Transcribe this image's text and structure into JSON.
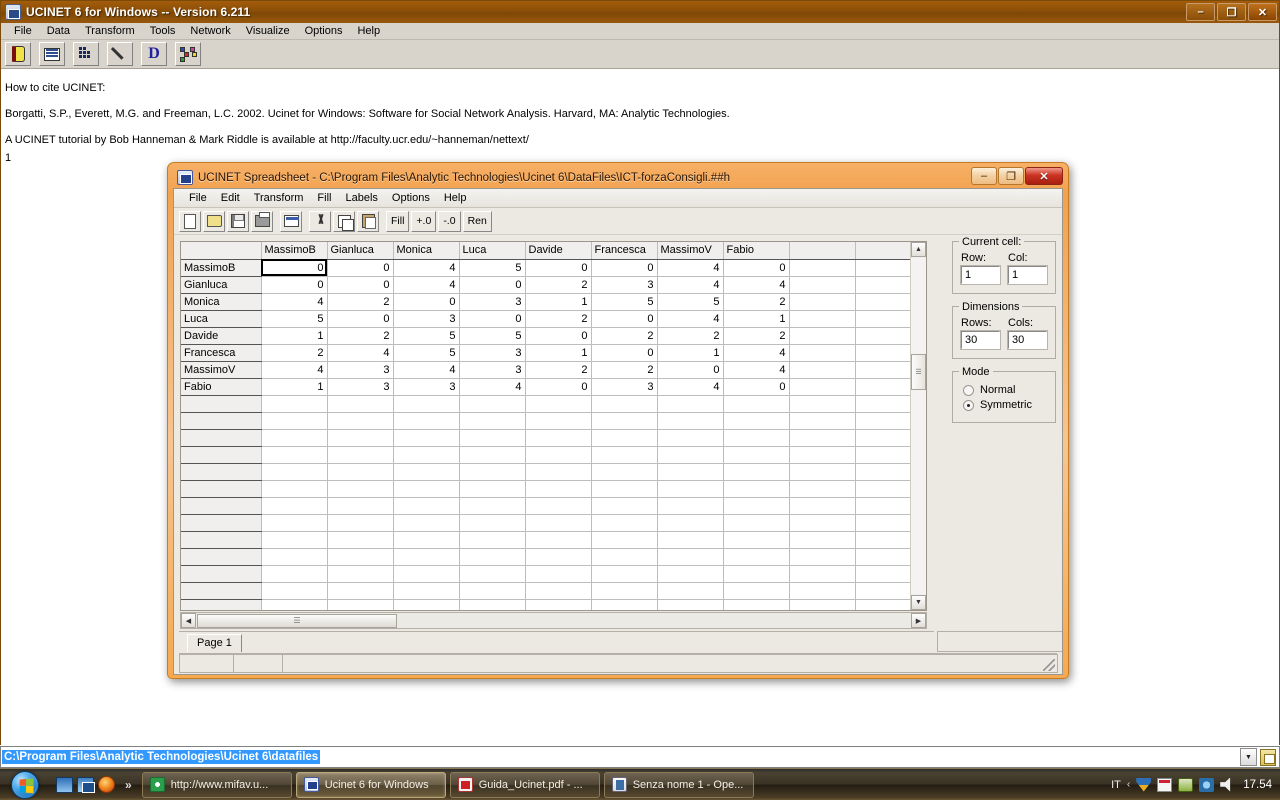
{
  "main_window": {
    "title": "UCINET 6 for Windows -- Version 6.211",
    "icon": "ucinet-app-icon",
    "window_buttons": {
      "minimize": "–",
      "maximize": "❐",
      "close": "✕"
    },
    "menu": [
      "File",
      "Data",
      "Transform",
      "Tools",
      "Network",
      "Visualize",
      "Options",
      "Help"
    ],
    "toolbar": [
      {
        "name": "exit-door-icon",
        "glyph": "door"
      },
      {
        "name": "spreadsheet-icon",
        "glyph": "sheet"
      },
      {
        "name": "matrix-icon",
        "glyph": "matrix"
      },
      {
        "name": "pencil-icon",
        "glyph": "pencil"
      },
      {
        "name": "display-d-icon",
        "glyph": "D"
      },
      {
        "name": "network-graph-icon",
        "glyph": "net"
      }
    ],
    "citation": {
      "heading": "How to cite UCINET:",
      "reference": "Borgatti, S.P., Everett, M.G. and Freeman, L.C. 2002. Ucinet for Windows: Software for Social Network Analysis. Harvard, MA: Analytic Technologies.",
      "tutorial": "A UCINET tutorial by Bob Hanneman & Mark Riddle is available at http://faculty.ucr.edu/~hanneman/nettext/",
      "line_number": "1"
    }
  },
  "spreadsheet_window": {
    "title": "UCINET Spreadsheet - C:\\Program Files\\Analytic Technologies\\Ucinet 6\\DataFiles\\ICT-forzaConsigli.##h",
    "window_buttons": {
      "minimize": "–",
      "maximize": "❐",
      "close": "✕"
    },
    "menu": [
      "File",
      "Edit",
      "Transform",
      "Fill",
      "Labels",
      "Options",
      "Help"
    ],
    "toolbar": {
      "icons": [
        {
          "name": "new-file-icon",
          "glyph": "doc"
        },
        {
          "name": "open-file-icon",
          "glyph": "open"
        },
        {
          "name": "save-file-icon",
          "glyph": "save"
        },
        {
          "name": "print-icon",
          "glyph": "print"
        },
        {
          "name": "chart-icon",
          "glyph": "chart"
        },
        {
          "name": "cut-icon",
          "glyph": "cut"
        },
        {
          "name": "copy-icon",
          "glyph": "copy"
        },
        {
          "name": "paste-icon",
          "glyph": "paste"
        }
      ],
      "text_buttons": [
        {
          "name": "fill-button",
          "label": "Fill"
        },
        {
          "name": "increase-decimals-button",
          "label": "+.0"
        },
        {
          "name": "decrease-decimals-button",
          "label": "-.0"
        },
        {
          "name": "rename-button",
          "label": "Ren"
        }
      ]
    },
    "grid": {
      "column_headers": [
        "MassimoB",
        "Gianluca",
        "Monica",
        "Luca",
        "Davide",
        "Francesca",
        "MassimoV",
        "Fabio"
      ],
      "row_headers": [
        "MassimoB",
        "Gianluca",
        "Monica",
        "Luca",
        "Davide",
        "Francesca",
        "MassimoV",
        "Fabio"
      ],
      "rows": [
        [
          "0",
          "0",
          "4",
          "5",
          "0",
          "0",
          "4",
          "0"
        ],
        [
          "0",
          "0",
          "4",
          "0",
          "2",
          "3",
          "4",
          "4"
        ],
        [
          "4",
          "2",
          "0",
          "3",
          "1",
          "5",
          "5",
          "2"
        ],
        [
          "5",
          "0",
          "3",
          "0",
          "2",
          "0",
          "4",
          "1"
        ],
        [
          "1",
          "2",
          "5",
          "5",
          "0",
          "2",
          "2",
          "2"
        ],
        [
          "2",
          "4",
          "5",
          "3",
          "1",
          "0",
          "1",
          "4"
        ],
        [
          "4",
          "3",
          "4",
          "3",
          "2",
          "2",
          "0",
          "4"
        ],
        [
          "1",
          "3",
          "3",
          "4",
          "0",
          "3",
          "4",
          "0"
        ]
      ],
      "empty_trailing_columns": 2,
      "empty_rows_count": 13,
      "selected_cell": {
        "row": 1,
        "col": 1,
        "value": "0"
      }
    },
    "panel": {
      "current_cell": {
        "title": "Current cell:",
        "row_label": "Row:",
        "row_value": "1",
        "col_label": "Col:",
        "col_value": "1"
      },
      "dimensions": {
        "title": "Dimensions",
        "rows_label": "Rows:",
        "rows_value": "30",
        "cols_label": "Cols:",
        "cols_value": "30"
      },
      "mode": {
        "title": "Mode",
        "options": [
          {
            "label": "Normal",
            "selected": false
          },
          {
            "label": "Symmetric",
            "selected": true
          }
        ]
      }
    },
    "page_tab": "Page 1",
    "scrollbars": {
      "up_arrow": "▲",
      "down_arrow": "▼",
      "left_arrow": "◀",
      "right_arrow": "▶",
      "grip": "∣∣∣"
    }
  },
  "path_bar": {
    "value": "C:\\Program Files\\Analytic Technologies\\Ucinet 6\\datafiles",
    "dropdown_arrow": "▼",
    "icon": "folder-properties-icon"
  },
  "taskbar": {
    "start_label": "start-orb",
    "quick_launch": [
      {
        "name": "show-desktop-icon"
      },
      {
        "name": "switch-windows-icon"
      },
      {
        "name": "firefox-icon"
      }
    ],
    "quick_launch_chevron": "»",
    "items": [
      {
        "name": "taskbar-item-chrome",
        "label": "http://www.mifav.u...",
        "icon": "chrome",
        "active": false
      },
      {
        "name": "taskbar-item-ucinet",
        "label": "Ucinet 6 for Windows",
        "icon": "ucinet",
        "active": true
      },
      {
        "name": "taskbar-item-pdf",
        "label": "Guida_Ucinet.pdf - ...",
        "icon": "pdf",
        "active": false
      },
      {
        "name": "taskbar-item-openoffice",
        "label": "Senza nome 1 - Ope...",
        "icon": "ooo",
        "active": false
      }
    ],
    "tray": {
      "language": "IT",
      "chevron": "‹",
      "icons": [
        "security-shield-icon",
        "action-center-icon",
        "battery-icon",
        "network-icon",
        "volume-icon"
      ],
      "clock": "17.54"
    }
  },
  "colors": {
    "main_titlebar": "#8b4f07",
    "sheet_frame": "#f2a24f",
    "selection_blue": "#3399ff",
    "grid_header": "#f0efed"
  }
}
